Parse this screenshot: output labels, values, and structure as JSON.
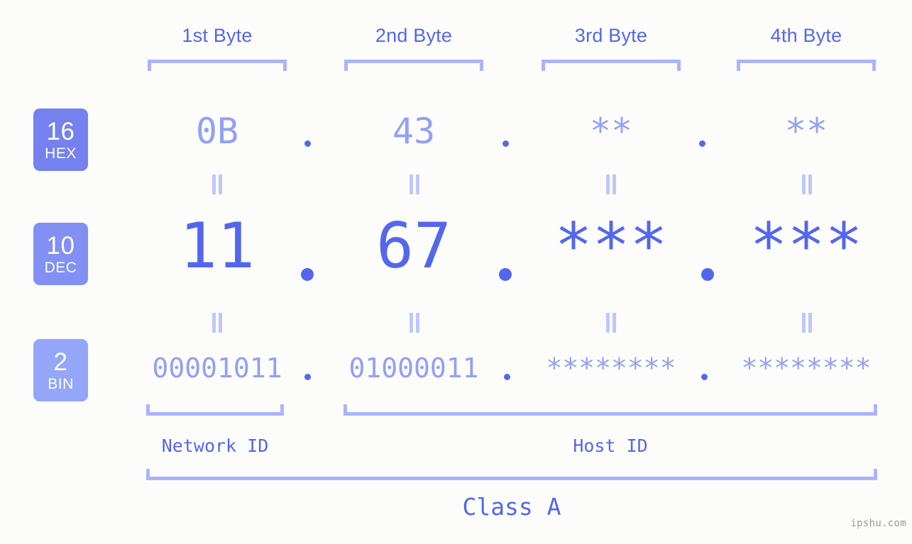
{
  "colors": {
    "background": "#fcfdfa",
    "accent_strong": "#5566ee",
    "accent_mid": "#93a0f5",
    "accent_light": "#aab4fb",
    "accent_pale": "#bfc7fb",
    "badge_hex": "#7481ee",
    "badge_dec": "#8190f2",
    "badge_bin": "#93a6f7",
    "watermark": "#9a9a9a"
  },
  "byte_headers": [
    {
      "label": "1st Byte"
    },
    {
      "label": "2nd Byte"
    },
    {
      "label": "3rd Byte"
    },
    {
      "label": "4th Byte"
    }
  ],
  "radix_badges": [
    {
      "number": "16",
      "unit": "HEX"
    },
    {
      "number": "10",
      "unit": "DEC"
    },
    {
      "number": "2",
      "unit": "BIN"
    }
  ],
  "rows": {
    "hex": {
      "radix": "16",
      "unit": "HEX",
      "values": [
        "0B",
        "43",
        "**",
        "**"
      ],
      "separator": "."
    },
    "dec": {
      "radix": "10",
      "unit": "DEC",
      "values": [
        "11",
        "67",
        "***",
        "***"
      ],
      "separator": "."
    },
    "bin": {
      "radix": "2",
      "unit": "BIN",
      "values": [
        "00001011",
        "01000011",
        "********",
        "********"
      ],
      "separator": "."
    }
  },
  "equals_marker": "||",
  "regions": [
    {
      "label": "Network ID"
    },
    {
      "label": "Host ID"
    }
  ],
  "class_label": "Class A",
  "watermark": "ipshu.com"
}
